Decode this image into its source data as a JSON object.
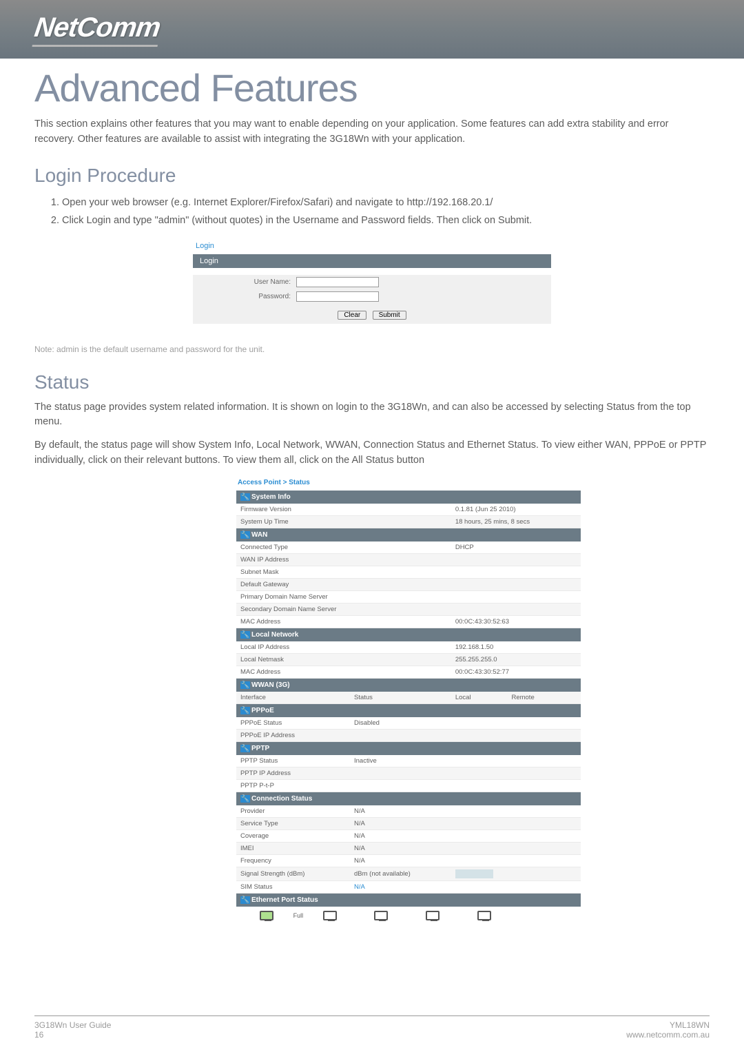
{
  "header": {
    "logo_text": "NetComm"
  },
  "main_title": "Advanced Features",
  "intro_text": "This section explains other features that you may want to enable depending on your application. Some features can add extra stability and error recovery. Other features are available to assist with integrating the 3G18Wn with your application.",
  "login_section": {
    "heading": "Login Procedure",
    "steps": [
      "Open your web browser (e.g. Internet Explorer/Firefox/Safari) and navigate to http://192.168.20.1/",
      "Click Login and type \"admin\" (without quotes) in the Username and Password fields. Then click on Submit."
    ]
  },
  "login_screenshot": {
    "head_link": "Login",
    "box_header": "Login",
    "username_label": "User Name:",
    "password_label": "Password:",
    "clear_label": "Clear",
    "submit_label": "Submit"
  },
  "login_note": "Note: admin is the default username and password for the unit.",
  "status_section": {
    "heading": "Status",
    "para1": "The status page provides system related information. It is shown on login to the 3G18Wn, and can also be accessed by selecting Status from the top menu.",
    "para2": "By default, the status page will show System Info, Local Network, WWAN, Connection Status and Ethernet Status. To view either WAN, PPPoE or PPTP individually, click on their relevant buttons. To view them all, click on the All Status button"
  },
  "status_screenshot": {
    "breadcrumb": "Access Point > Status",
    "sections": {
      "system_info": {
        "title": "System Info",
        "rows": [
          {
            "label": "Firmware Version",
            "value": "0.1.81 (Jun 25 2010)"
          },
          {
            "label": "System Up Time",
            "value": "18 hours, 25 mins, 8 secs"
          }
        ]
      },
      "wan": {
        "title": "WAN",
        "rows": [
          {
            "label": "Connected Type",
            "value": "DHCP"
          },
          {
            "label": "WAN IP Address",
            "value": ""
          },
          {
            "label": "Subnet Mask",
            "value": ""
          },
          {
            "label": "Default Gateway",
            "value": ""
          },
          {
            "label": "Primary Domain Name Server",
            "value": ""
          },
          {
            "label": "Secondary Domain Name Server",
            "value": ""
          },
          {
            "label": "MAC Address",
            "value": "00:0C:43:30:52:63"
          }
        ]
      },
      "local_network": {
        "title": "Local Network",
        "rows": [
          {
            "label": "Local IP Address",
            "value": "192.168.1.50"
          },
          {
            "label": "Local Netmask",
            "value": "255.255.255.0"
          },
          {
            "label": "MAC Address",
            "value": "00:0C:43:30:52:77"
          }
        ]
      },
      "wwan": {
        "title": "WWAN (3G)",
        "header": {
          "c1": "Interface",
          "c2": "Status",
          "c3": "Local",
          "c4": "Remote"
        }
      },
      "pppoe": {
        "title": "PPPoE",
        "rows": [
          {
            "label": "PPPoE Status",
            "value": "Disabled"
          },
          {
            "label": "PPPoE IP Address",
            "value": ""
          }
        ]
      },
      "pptp": {
        "title": "PPTP",
        "rows": [
          {
            "label": "PPTP Status",
            "value": "Inactive"
          },
          {
            "label": "PPTP IP Address",
            "value": ""
          },
          {
            "label": "PPTP P-t-P",
            "value": ""
          }
        ]
      },
      "connection": {
        "title": "Connection Status",
        "rows": [
          {
            "label": "Provider",
            "value": "N/A"
          },
          {
            "label": "Service Type",
            "value": "N/A"
          },
          {
            "label": "Coverage",
            "value": "N/A"
          },
          {
            "label": "IMEI",
            "value": "N/A"
          },
          {
            "label": "Frequency",
            "value": "N/A"
          },
          {
            "label": "Signal Strength (dBm)",
            "value": "dBm (not available)"
          },
          {
            "label": "SIM Status",
            "value": "N/A"
          }
        ]
      },
      "ethernet": {
        "title": "Ethernet Port Status",
        "port_label": "Full"
      }
    }
  },
  "footer": {
    "left_line1": "3G18Wn User Guide",
    "left_line2": "16",
    "right_line1": "YML18WN",
    "right_line2": "www.netcomm.com.au"
  }
}
